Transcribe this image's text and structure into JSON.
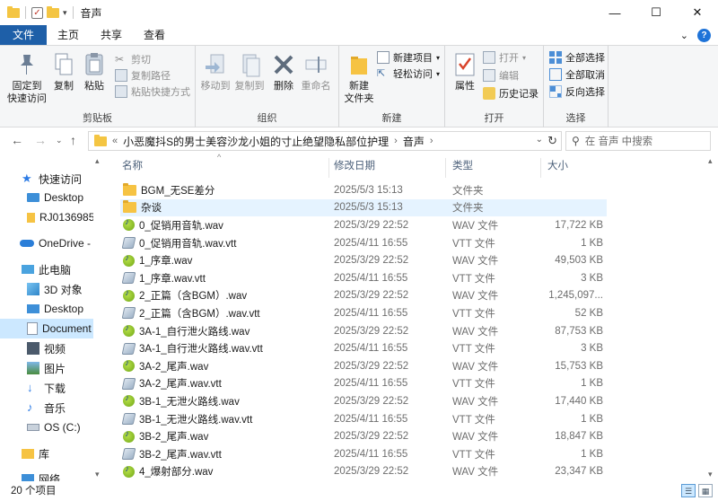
{
  "window": {
    "title": "音声",
    "minimize": "—",
    "maximize": "☐",
    "close": "✕"
  },
  "tabs": {
    "file": "文件",
    "home": "主页",
    "share": "共享",
    "view": "查看"
  },
  "ribbon": {
    "clipboard": {
      "label": "剪贴板",
      "pin": "固定到\n快速访问",
      "copy": "复制",
      "paste": "粘贴",
      "cut": "剪切",
      "copy_path": "复制路径",
      "paste_shortcut": "粘贴快捷方式"
    },
    "organize": {
      "label": "组织",
      "move_to": "移动到",
      "copy_to": "复制到",
      "delete": "删除",
      "rename": "重命名"
    },
    "new": {
      "label": "新建",
      "new_folder": "新建\n文件夹",
      "new_item": "新建项目",
      "easy_access": "轻松访问"
    },
    "open": {
      "label": "打开",
      "properties": "属性",
      "open": "打开",
      "edit": "编辑",
      "history": "历史记录"
    },
    "select": {
      "label": "选择",
      "select_all": "全部选择",
      "select_none": "全部取消",
      "invert": "反向选择"
    }
  },
  "address": {
    "path_root": "«",
    "path_parent": "小恶魔抖S的男士美容沙龙小姐的寸止绝望隐私部位护理",
    "path_current": "音声",
    "search_placeholder": "在 音声 中搜索"
  },
  "navpane": {
    "items": [
      {
        "label": "快速访问",
        "icon": "star-icon"
      },
      {
        "label": "Desktop",
        "icon": "desktop-icon"
      },
      {
        "label": "RJ0136985",
        "icon": "folder-icon"
      },
      {
        "label": "OneDrive -",
        "icon": "cloud-icon"
      },
      {
        "label": "此电脑",
        "icon": "computer-icon"
      },
      {
        "label": "3D 对象",
        "icon": "3d-objects-icon"
      },
      {
        "label": "Desktop",
        "icon": "desktop-icon"
      },
      {
        "label": "Document",
        "icon": "documents-icon"
      },
      {
        "label": "视频",
        "icon": "video-icon"
      },
      {
        "label": "图片",
        "icon": "pictures-icon"
      },
      {
        "label": "下载",
        "icon": "download-icon"
      },
      {
        "label": "音乐",
        "icon": "music-icon"
      },
      {
        "label": "OS (C:)",
        "icon": "drive-icon"
      },
      {
        "label": "库",
        "icon": "library-icon"
      },
      {
        "label": "网络",
        "icon": "network-icon"
      }
    ]
  },
  "columns": {
    "name": "名称",
    "date": "修改日期",
    "type": "类型",
    "size": "大小"
  },
  "files": [
    {
      "name": "BGM_无SE差分",
      "date": "2025/5/3 15:13",
      "type": "文件夹",
      "size": "",
      "icon": "folder"
    },
    {
      "name": "杂谈",
      "date": "2025/5/3 15:13",
      "type": "文件夹",
      "size": "",
      "icon": "folder"
    },
    {
      "name": "0_促销用音轨.wav",
      "date": "2025/3/29 22:52",
      "type": "WAV 文件",
      "size": "17,722 KB",
      "icon": "wav"
    },
    {
      "name": "0_促销用音轨.wav.vtt",
      "date": "2025/4/11 16:55",
      "type": "VTT 文件",
      "size": "1 KB",
      "icon": "vtt"
    },
    {
      "name": "1_序章.wav",
      "date": "2025/3/29 22:52",
      "type": "WAV 文件",
      "size": "49,503 KB",
      "icon": "wav"
    },
    {
      "name": "1_序章.wav.vtt",
      "date": "2025/4/11 16:55",
      "type": "VTT 文件",
      "size": "3 KB",
      "icon": "vtt"
    },
    {
      "name": "2_正篇（含BGM）.wav",
      "date": "2025/3/29 22:52",
      "type": "WAV 文件",
      "size": "1,245,097...",
      "icon": "wav"
    },
    {
      "name": "2_正篇（含BGM）.wav.vtt",
      "date": "2025/4/11 16:55",
      "type": "VTT 文件",
      "size": "52 KB",
      "icon": "vtt"
    },
    {
      "name": "3A-1_自行泄火路线.wav",
      "date": "2025/3/29 22:52",
      "type": "WAV 文件",
      "size": "87,753 KB",
      "icon": "wav"
    },
    {
      "name": "3A-1_自行泄火路线.wav.vtt",
      "date": "2025/4/11 16:55",
      "type": "VTT 文件",
      "size": "3 KB",
      "icon": "vtt"
    },
    {
      "name": "3A-2_尾声.wav",
      "date": "2025/3/29 22:52",
      "type": "WAV 文件",
      "size": "15,753 KB",
      "icon": "wav"
    },
    {
      "name": "3A-2_尾声.wav.vtt",
      "date": "2025/4/11 16:55",
      "type": "VTT 文件",
      "size": "1 KB",
      "icon": "vtt"
    },
    {
      "name": "3B-1_无泄火路线.wav",
      "date": "2025/3/29 22:52",
      "type": "WAV 文件",
      "size": "17,440 KB",
      "icon": "wav"
    },
    {
      "name": "3B-1_无泄火路线.wav.vtt",
      "date": "2025/4/11 16:55",
      "type": "VTT 文件",
      "size": "1 KB",
      "icon": "vtt"
    },
    {
      "name": "3B-2_尾声.wav",
      "date": "2025/3/29 22:52",
      "type": "WAV 文件",
      "size": "18,847 KB",
      "icon": "wav"
    },
    {
      "name": "3B-2_尾声.wav.vtt",
      "date": "2025/4/11 16:55",
      "type": "VTT 文件",
      "size": "1 KB",
      "icon": "vtt"
    },
    {
      "name": "4_爆射部分.wav",
      "date": "2025/3/29 22:52",
      "type": "WAV 文件",
      "size": "23,347 KB",
      "icon": "wav"
    }
  ],
  "status": {
    "count": "20 个项目"
  },
  "colors": {
    "accent": "#1e5fa8",
    "selection": "#cce8ff",
    "hover": "#e5f3ff"
  }
}
